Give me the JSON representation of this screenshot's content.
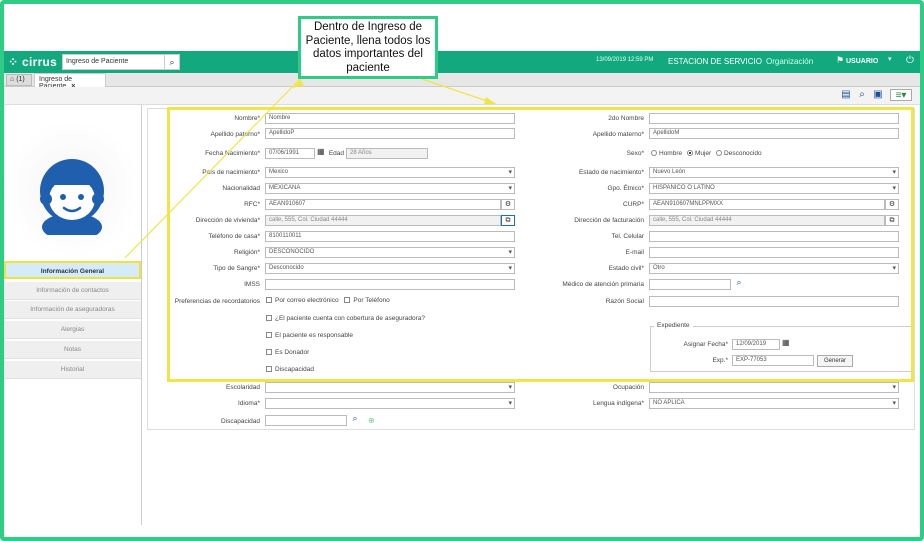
{
  "header": {
    "logo": "cirrus",
    "search_value": "Ingreso de Paciente",
    "datetime": "13/09/2019 12:59 PM",
    "station": "ESTACION DE SERVICIO",
    "org": "Organización",
    "user": "USUARIO"
  },
  "tabs": {
    "home_count": "(1)",
    "main_label": "Ingreso de Paciente",
    "close": "×"
  },
  "sidebar": {
    "items": [
      "Información General",
      "Información de contactos",
      "Información de aseguradoras",
      "Alergias",
      "Notas",
      "Historial"
    ]
  },
  "form": {
    "nombre_label": "Nombre*",
    "nombre_value": "Nombre",
    "nombre2_label": "2do Nombre",
    "nombre2_value": "",
    "ap_pat_label": "Apellido paterno*",
    "ap_pat_value": "ApellidoP",
    "ap_mat_label": "Apellido materno*",
    "ap_mat_value": "ApellidoM",
    "fnac_label": "Fecha Nacimiento*",
    "fnac_value": "07/06/1991",
    "edad_label": "Edad",
    "edad_value": "28 Años",
    "sexo_label": "Sexo*",
    "sexo_hombre": "Hombre",
    "sexo_mujer": "Mujer",
    "sexo_desc": "Desconocido",
    "pais_label": "País de nacimiento*",
    "pais_value": "Mexico",
    "estado_label": "Estado de nacimiento*",
    "estado_value": "Nuevo León",
    "nac_label": "Nacionalidad",
    "nac_value": "MEXICANA",
    "gpo_label": "Gpo. Étnico*",
    "gpo_value": "HISPANICO O LATINO",
    "rfc_label": "RFC*",
    "rfc_value": "AEAN910607",
    "curp_label": "CURP*",
    "curp_value": "AEAN910607MNLPPMXX",
    "dirv_label": "Dirección de vivienda*",
    "dirv_value": "calle, 555, Col.   Ciudad  44444",
    "dirf_label": "Dirección de facturación",
    "dirf_value": "calle, 555, Col.   Ciudad  44444",
    "tel_label": "Teléfono de casa*",
    "tel_value": "8100110011",
    "cel_label": "Tel. Celular",
    "cel_value": "",
    "rel_label": "Religión*",
    "rel_value": "DESCONOCIDO",
    "email_label": "E-mail",
    "email_value": "",
    "sangre_label": "Tipo de Sangre*",
    "sangre_value": "Desconocido",
    "civil_label": "Estado civil*",
    "civil_value": "Otro",
    "imss_label": "IMSS",
    "imss_value": "",
    "medico_label": "Médico de atención primaria",
    "medico_value": "",
    "pref_label": "Preferencias de recordatorios",
    "pref_correo": "Por correo electrónico",
    "pref_tel": "Por Teléfono",
    "razon_label": "Razón Social",
    "razon_value": "",
    "chk_aseg": "¿El paciente cuenta con cobertura de aseguradora?",
    "chk_resp": "El paciente es responsable",
    "chk_donador": "Es Donador",
    "chk_disc": "Discapacidad",
    "exp_legend": "Expediente",
    "asignar_label": "Asignar Fecha*",
    "asignar_value": "12/09/2019",
    "exp_label": "Exp.*",
    "exp_value": "EXP-77053",
    "generar": "Generar",
    "escol_label": "Escolaridad",
    "escol_value": "",
    "ocup_label": "Ocupación",
    "ocup_value": "",
    "idioma_label": "Idioma*",
    "idioma_value": "",
    "lengua_label": "Lengua indígena*",
    "lengua_value": "NO APLICA",
    "disc_label": "Discapacidad",
    "disc_value": ""
  },
  "callout": {
    "text": "Dentro de Ingreso de Paciente, llena todos los datos importantes del paciente"
  },
  "colors": {
    "brand": "#12a97e",
    "highlight": "#f1e448",
    "frame": "#2ecc85",
    "avatar": "#1f5fae"
  }
}
